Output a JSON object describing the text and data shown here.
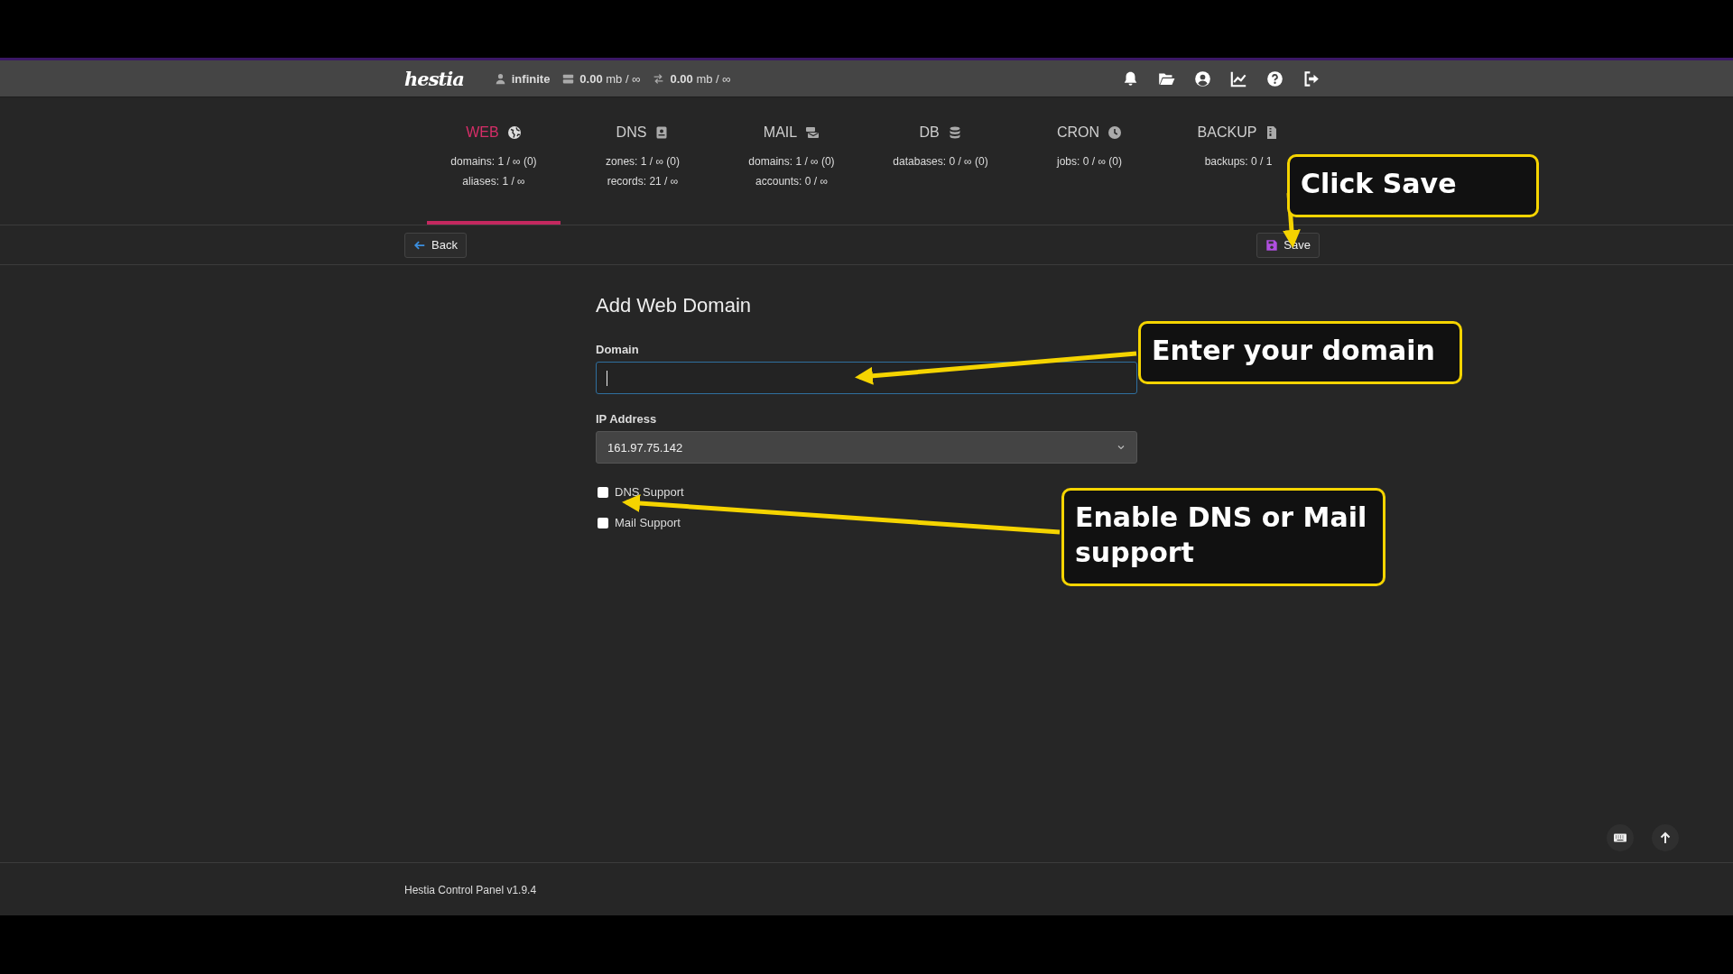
{
  "header": {
    "logo": "hestia",
    "user": "infinite",
    "disk": "**0.00** mb / ∞",
    "bandwidth": "**0.00** mb / ∞"
  },
  "tabs": [
    {
      "label": "WEB",
      "selected": true,
      "stats": [
        "domains: 1 / ∞ (0)",
        "aliases: 1 / ∞"
      ]
    },
    {
      "label": "DNS",
      "selected": false,
      "stats": [
        "zones: 1 / ∞ (0)",
        "records: 21 / ∞"
      ]
    },
    {
      "label": "MAIL",
      "selected": false,
      "stats": [
        "domains: 1 / ∞ (0)",
        "accounts: 0 / ∞"
      ]
    },
    {
      "label": "DB",
      "selected": false,
      "stats": [
        "databases: 0 / ∞ (0)"
      ]
    },
    {
      "label": "CRON",
      "selected": false,
      "stats": [
        "jobs: 0 / ∞ (0)"
      ]
    },
    {
      "label": "BACKUP",
      "selected": false,
      "stats": [
        "backups: 0 / 1"
      ]
    }
  ],
  "toolbar": {
    "back": "Back",
    "save": "Save"
  },
  "form": {
    "title": "Add Web Domain",
    "fields": [
      {
        "kind": "text",
        "label": "Domain",
        "focused": true
      },
      {
        "kind": "select",
        "label": "IP Address",
        "value": "161.97.75.142"
      }
    ],
    "checkboxes": [
      {
        "label": "DNS Support",
        "checked": false
      },
      {
        "label": "Mail Support",
        "checked": false
      }
    ]
  },
  "callouts": [
    {
      "text": "Click Save"
    },
    {
      "text": "Enter your domain"
    },
    {
      "text": "Enable DNS or Mail support"
    }
  ],
  "footer": {
    "text": "Hestia Control Panel v1.9.4"
  }
}
